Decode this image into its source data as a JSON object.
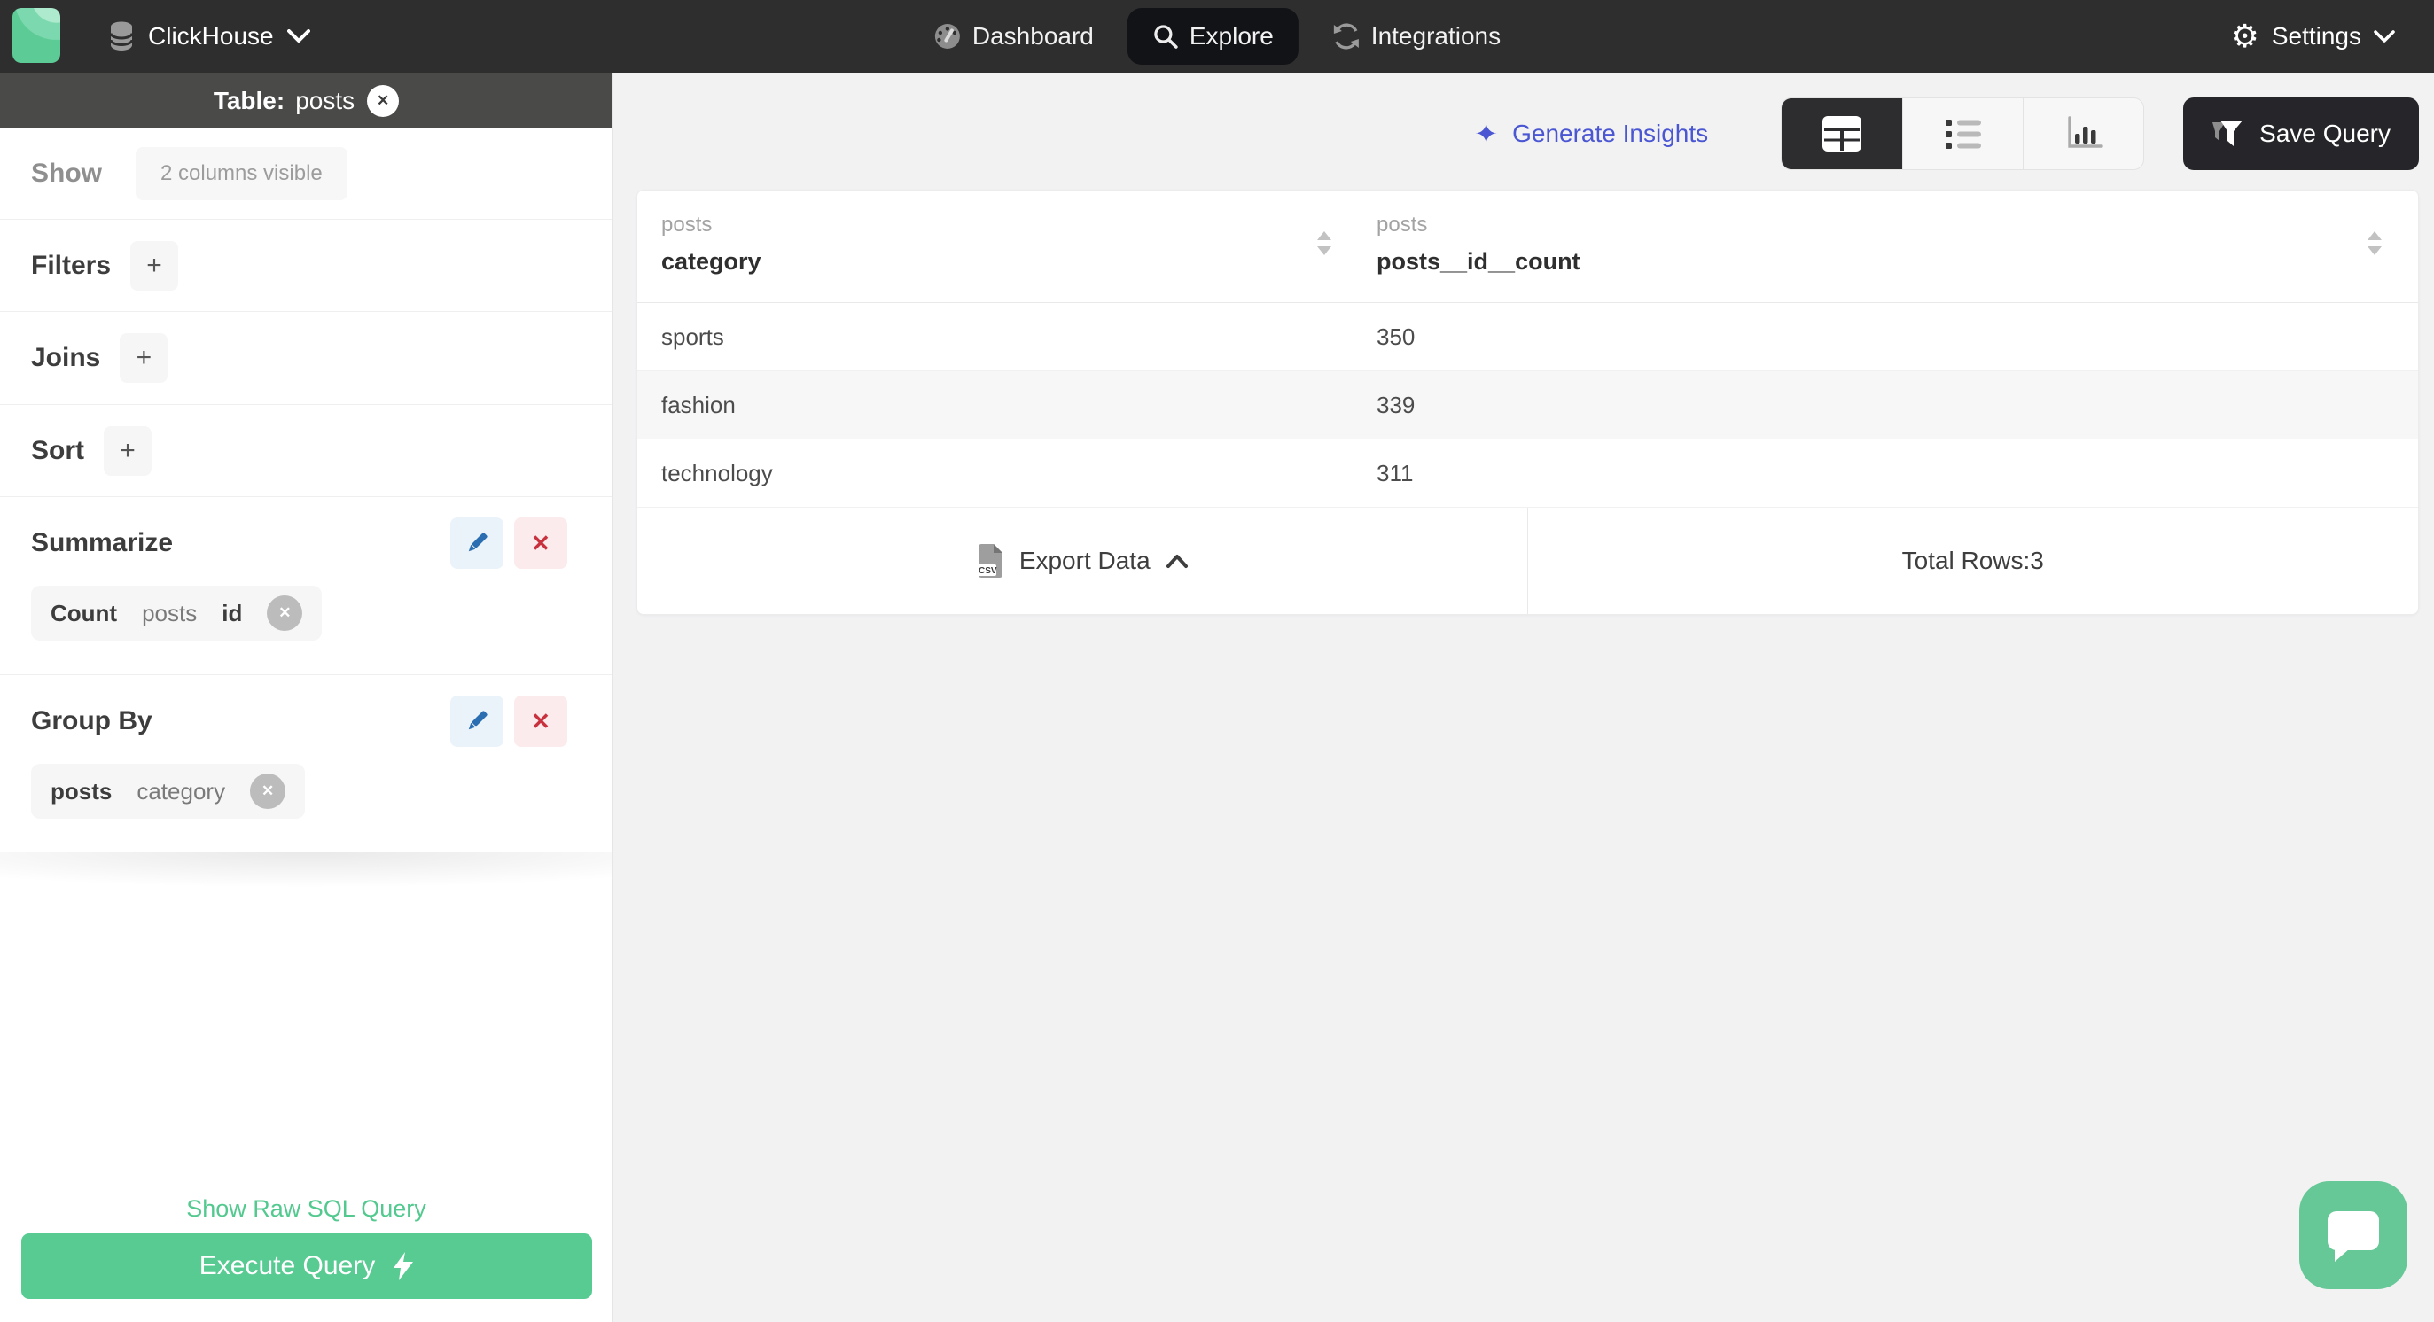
{
  "topbar": {
    "brand_name": "ClickHouse",
    "nav": [
      {
        "label": "Dashboard"
      },
      {
        "label": "Explore"
      },
      {
        "label": "Integrations"
      }
    ],
    "settings_label": "Settings"
  },
  "sidebar": {
    "table_label_prefix": "Table:",
    "table_name": "posts",
    "show_label": "Show",
    "columns_visible_label": "2 columns visible",
    "filters_label": "Filters",
    "joins_label": "Joins",
    "sort_label": "Sort",
    "summarize_label": "Summarize",
    "summarize_chip": {
      "agg": "Count",
      "table": "posts",
      "column": "id"
    },
    "group_by_label": "Group By",
    "group_by_chip": {
      "table": "posts",
      "column": "category"
    },
    "raw_sql_label": "Show Raw SQL Query",
    "execute_label": "Execute Query"
  },
  "main": {
    "insights_label": "Generate Insights",
    "save_query_label": "Save Query",
    "table": {
      "columns": [
        {
          "group": "posts",
          "name": "category"
        },
        {
          "group": "posts",
          "name": "posts__id__count"
        }
      ],
      "rows": [
        [
          "sports",
          "350"
        ],
        [
          "fashion",
          "339"
        ],
        [
          "technology",
          "311"
        ]
      ]
    },
    "footer": {
      "export_label": "Export Data",
      "total_rows_label": "Total Rows:3"
    }
  },
  "glyphs": {
    "gear": "⚙",
    "sparkle": "✦",
    "plus": "+",
    "close": "✕",
    "csv": "CSV"
  },
  "colors": {
    "accent_green": "#58cb93",
    "accent_indigo": "#4a56d2",
    "danger_red": "#c8323e",
    "topbar_dark": "#2e2e2e",
    "active_dark": "#2d2d30",
    "sidebar_header_gray": "#4a4a49"
  }
}
